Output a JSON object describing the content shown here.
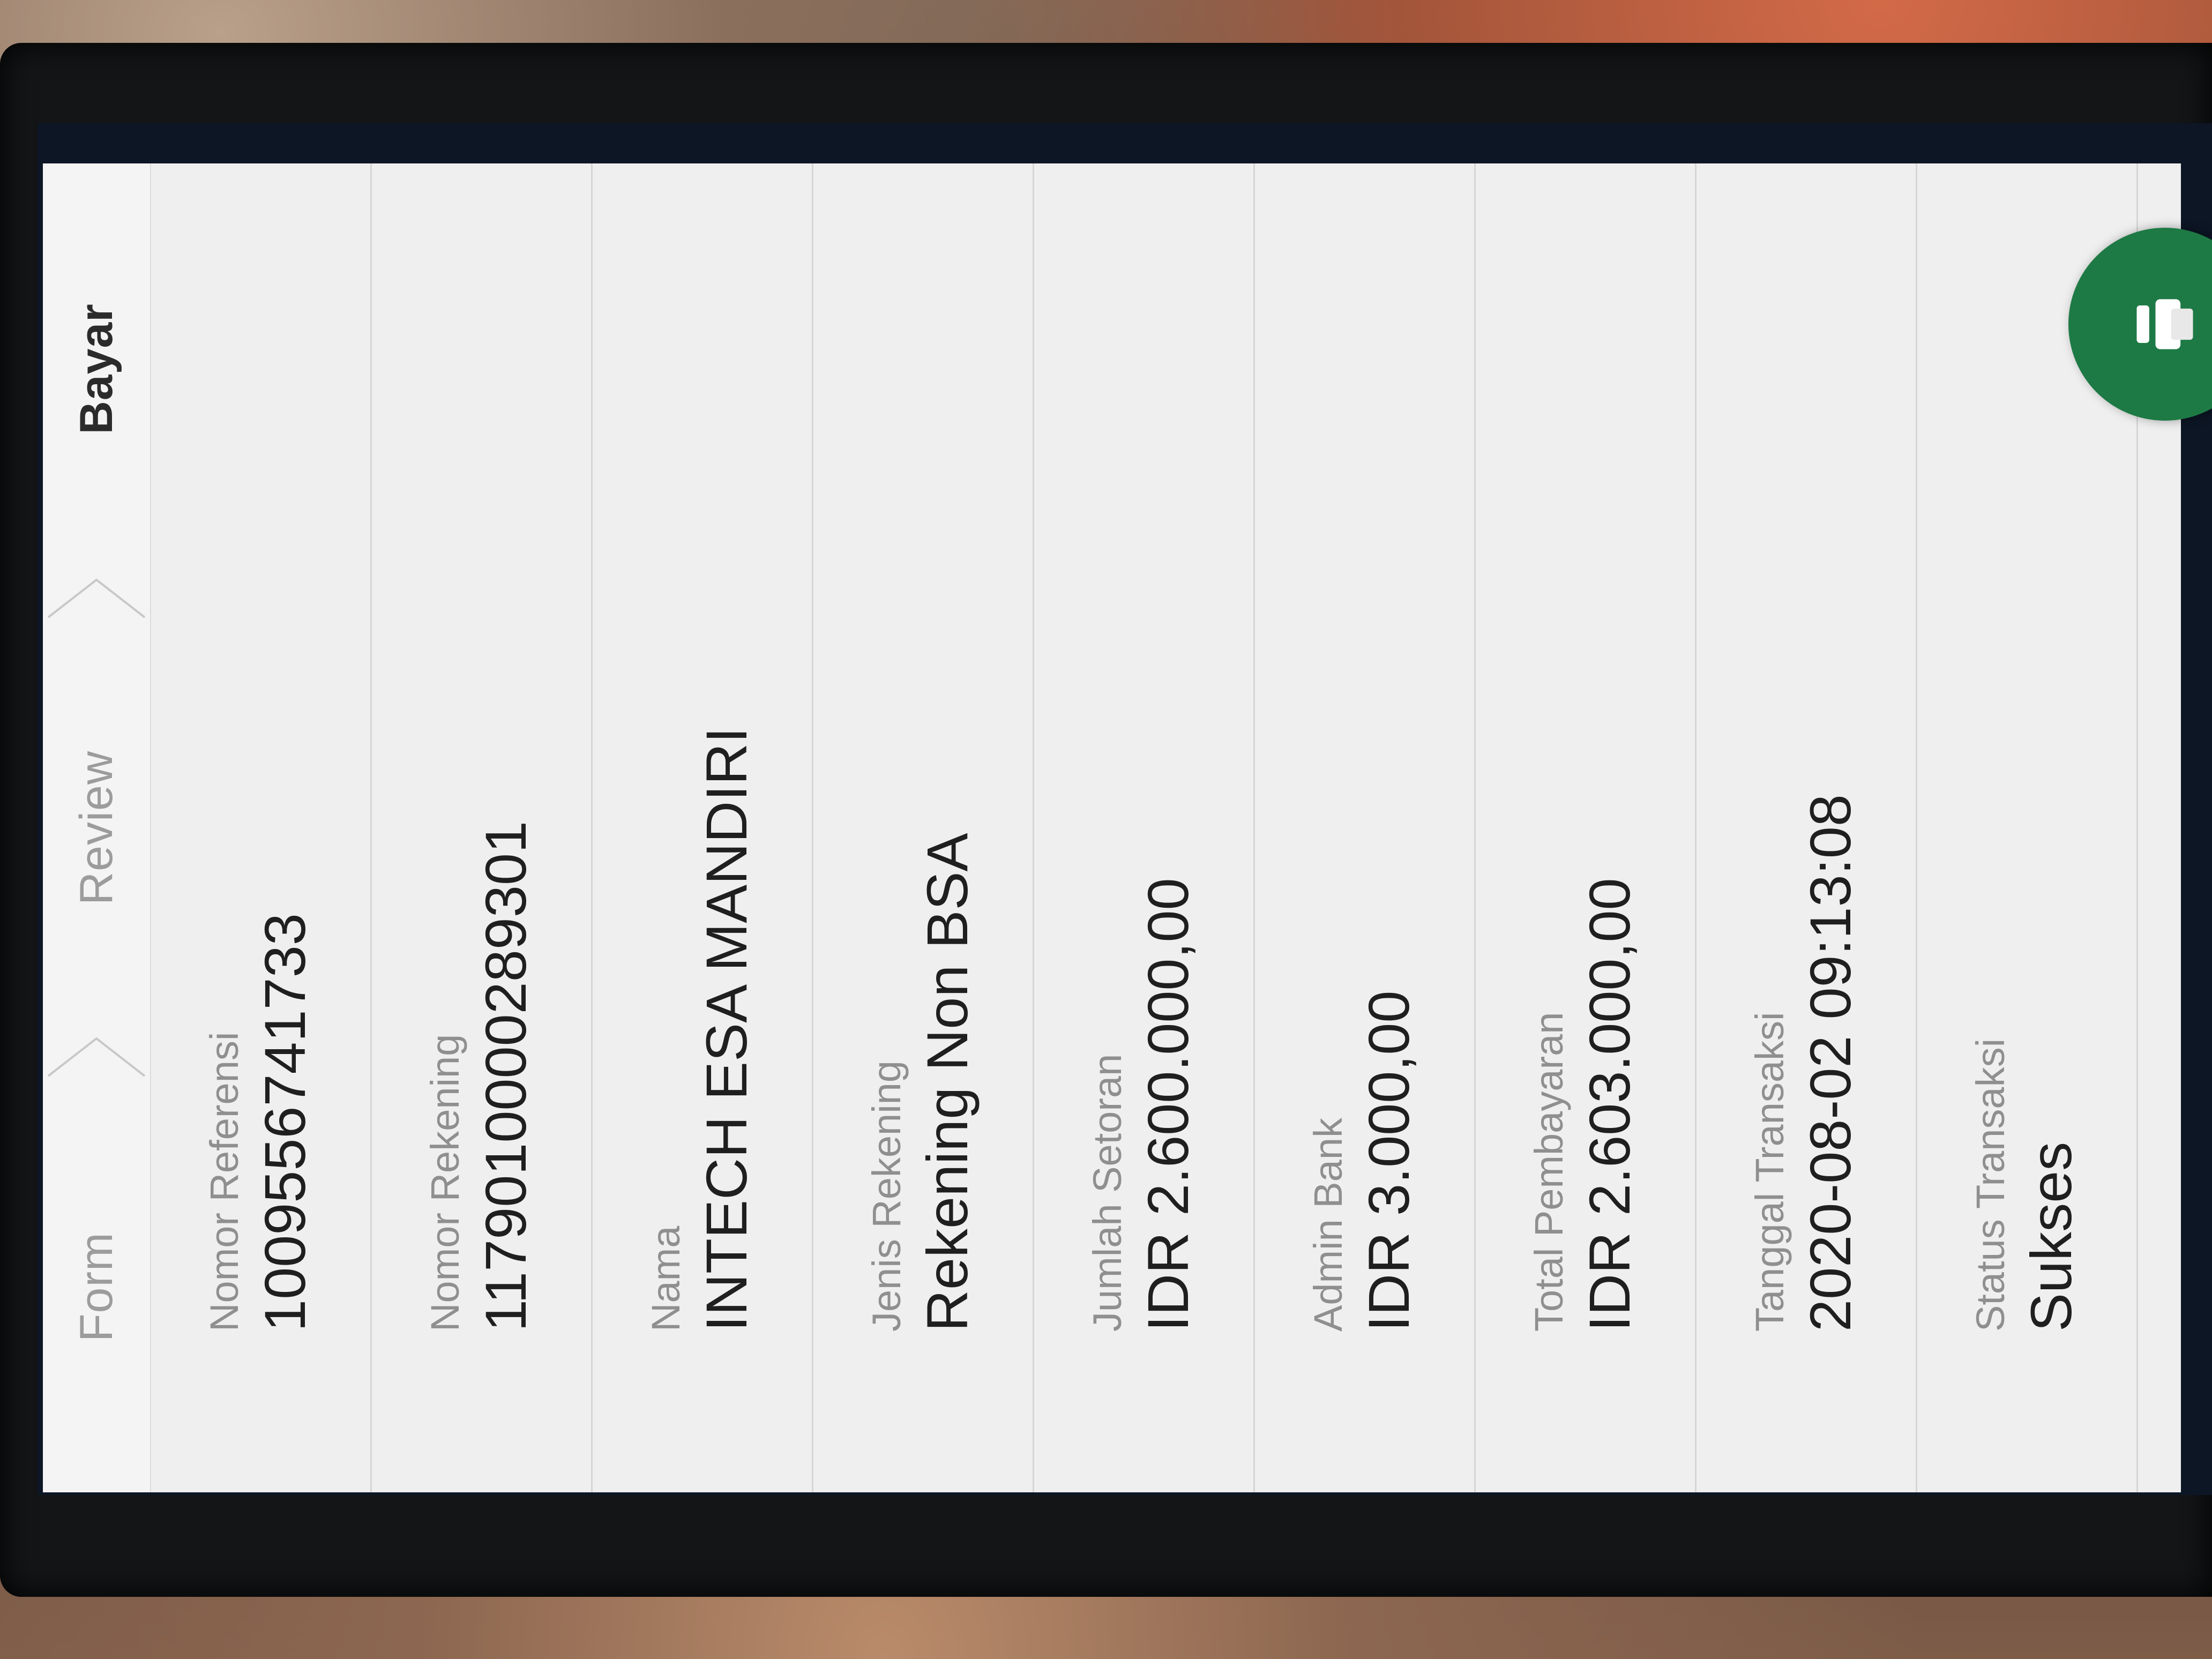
{
  "stepper": {
    "steps": [
      {
        "label": "Form"
      },
      {
        "label": "Review"
      },
      {
        "label": "Bayar"
      }
    ],
    "active_step": "Bayar"
  },
  "details": [
    {
      "label": "Nomor Referensi",
      "value": "1009556741733"
    },
    {
      "label": "Nomor Rekening",
      "value": "1179010000289301"
    },
    {
      "label": "Nama",
      "value": "INTECH ESA MANDIRI"
    },
    {
      "label": "Jenis Rekening",
      "value": "Rekening Non BSA"
    },
    {
      "label": "Jumlah Setoran",
      "value": "IDR 2.600.000,00"
    },
    {
      "label": "Admin Bank",
      "value": "IDR 3.000,00"
    },
    {
      "label": "Total Pembayaran",
      "value": "IDR 2.603.000,00"
    },
    {
      "label": "Tanggal Transaksi",
      "value": "2020-08-02 09:13:08"
    },
    {
      "label": "Status Transaksi",
      "value": "Sukses"
    }
  ],
  "fab": {
    "icon": "share-icon",
    "color": "#1e7a45"
  },
  "colors": {
    "screen_bg": "#efefef",
    "label": "#8f8f8f",
    "value": "#1f1f1f"
  }
}
